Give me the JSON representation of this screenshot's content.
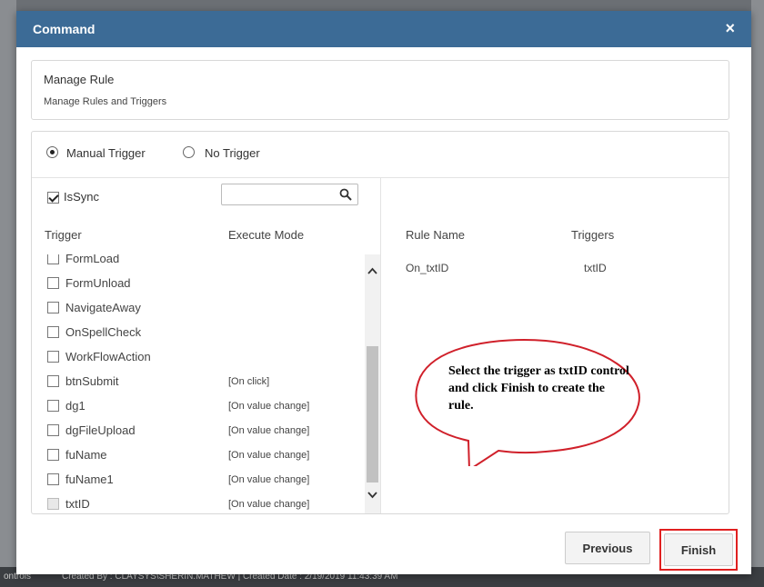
{
  "dialog": {
    "title": "Command",
    "close_label": "×",
    "manage_rule": {
      "title": "Manage Rule",
      "subtitle": "Manage Rules and Triggers"
    },
    "trigger_options": {
      "manual": "Manual Trigger",
      "none": "No Trigger",
      "selected": "manual"
    },
    "issync": {
      "label": "IsSync",
      "checked": true
    },
    "search": {
      "placeholder": "",
      "value": ""
    },
    "trigger_table": {
      "headers": {
        "trigger": "Trigger",
        "mode": "Execute Mode"
      },
      "rows": [
        {
          "name": "FormLoad",
          "mode": ""
        },
        {
          "name": "FormUnload",
          "mode": ""
        },
        {
          "name": "NavigateAway",
          "mode": ""
        },
        {
          "name": "OnSpellCheck",
          "mode": ""
        },
        {
          "name": "WorkFlowAction",
          "mode": ""
        },
        {
          "name": "btnSubmit",
          "mode": "[On click]"
        },
        {
          "name": "dg1",
          "mode": "[On value change]"
        },
        {
          "name": "dgFileUpload",
          "mode": "[On value change]"
        },
        {
          "name": "fuName",
          "mode": "[On value change]"
        },
        {
          "name": "fuName1",
          "mode": "[On value change]"
        },
        {
          "name": "txtID",
          "mode": "[On value change]"
        }
      ]
    },
    "rules_table": {
      "headers": {
        "rule_name": "Rule Name",
        "triggers": "Triggers"
      },
      "rows": [
        {
          "rule_name": "On_txtID",
          "triggers": "txtID"
        }
      ]
    },
    "callout_text": "Select the trigger as txtID control and  click Finish to create the rule.",
    "buttons": {
      "previous": "Previous",
      "finish": "Finish"
    }
  },
  "background": {
    "footer_left": "ontrols",
    "footer_info": "Created By : CLAYSYS\\SHERIN.MATHEW | Created Date : 2/19/2019 11:43:39 AM"
  },
  "colors": {
    "header": "#3c6b96",
    "highlight": "#e02020",
    "callout_border": "#d0202a"
  }
}
